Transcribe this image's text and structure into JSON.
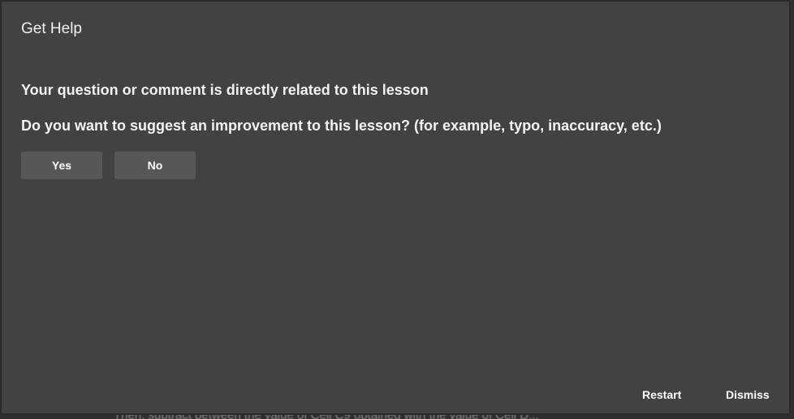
{
  "background": {
    "partial_text": "Then, subtract between the value of Cell C9 obtained with the value of Cell D..."
  },
  "dialog": {
    "title": "Get Help",
    "statement": "Your question or comment is directly related to this lesson",
    "question": "Do you want to suggest an improvement to this lesson? (for example, typo, inaccuracy, etc.)",
    "yes_label": "Yes",
    "no_label": "No",
    "restart_label": "Restart",
    "dismiss_label": "Dismiss"
  },
  "colors": {
    "dialog_bg": "#424242",
    "button_bg": "#575757",
    "text": "#f2f2f2"
  }
}
